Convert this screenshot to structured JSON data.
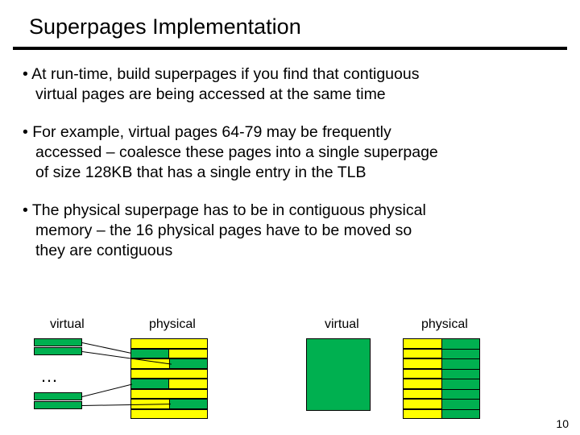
{
  "title": "Superpages Implementation",
  "bullets": [
    {
      "l1": "• At run-time, build superpages if you find that contiguous",
      "l2": "virtual pages are being accessed at the same time"
    },
    {
      "l1": "• For example, virtual pages 64-79 may be frequently",
      "l2": "accessed – coalesce these pages into a single superpage",
      "l3": "of size 128KB that has a single entry in the TLB"
    },
    {
      "l1": "• The physical superpage has to be in contiguous physical",
      "l2": "memory – the 16 physical pages have to be moved so",
      "l3": "they are contiguous"
    }
  ],
  "labels": {
    "virtual": "virtual",
    "physical": "physical",
    "dots": "…"
  },
  "page_number": "10"
}
